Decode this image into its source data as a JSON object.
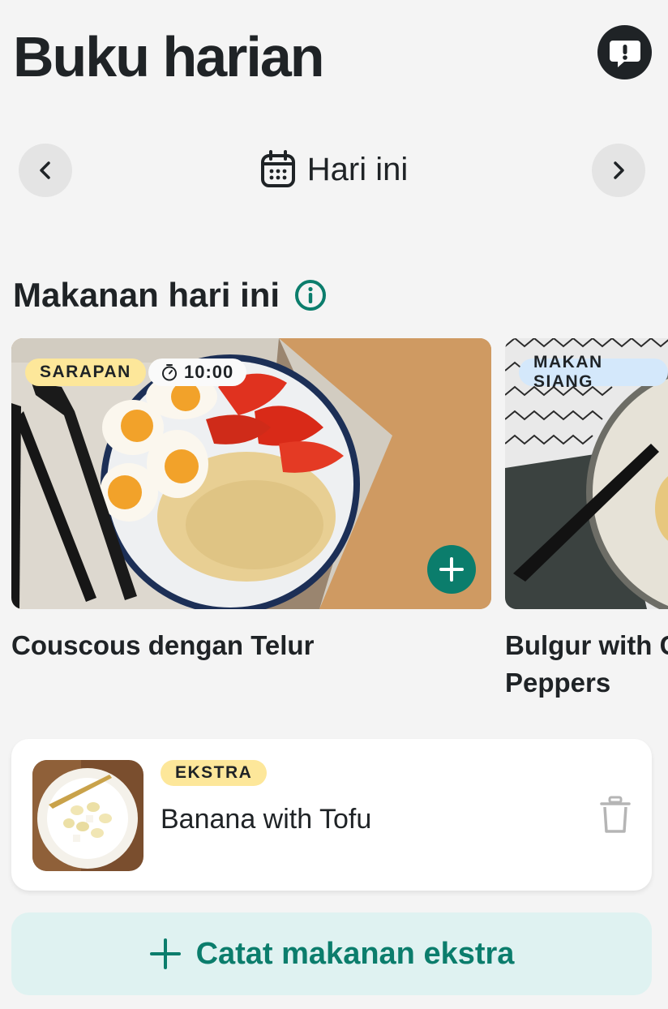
{
  "header": {
    "title": "Buku harian",
    "feedback_icon": "feedback-exclamation-icon"
  },
  "date_nav": {
    "label": "Hari ini",
    "prev_icon": "chevron-left-icon",
    "next_icon": "chevron-right-icon",
    "calendar_icon": "calendar-icon"
  },
  "section": {
    "title": "Makanan hari ini",
    "info_icon": "info-icon"
  },
  "meals": [
    {
      "type_label": "SARAPAN",
      "time": "10:00",
      "name": "Couscous dengan Telur"
    },
    {
      "type_label": "MAKAN SIANG",
      "name_line1": "Bulgur with C",
      "name_line2": "Peppers"
    }
  ],
  "extra": {
    "badge": "EKSTRA",
    "name": "Banana with Tofu"
  },
  "add_extra": {
    "label": "Catat makanan ekstra"
  },
  "colors": {
    "accent": "#0b7d6c",
    "badge_yellow": "#fde79a",
    "badge_blue": "#d4e8fb",
    "add_extra_bg": "#dff2f1"
  }
}
